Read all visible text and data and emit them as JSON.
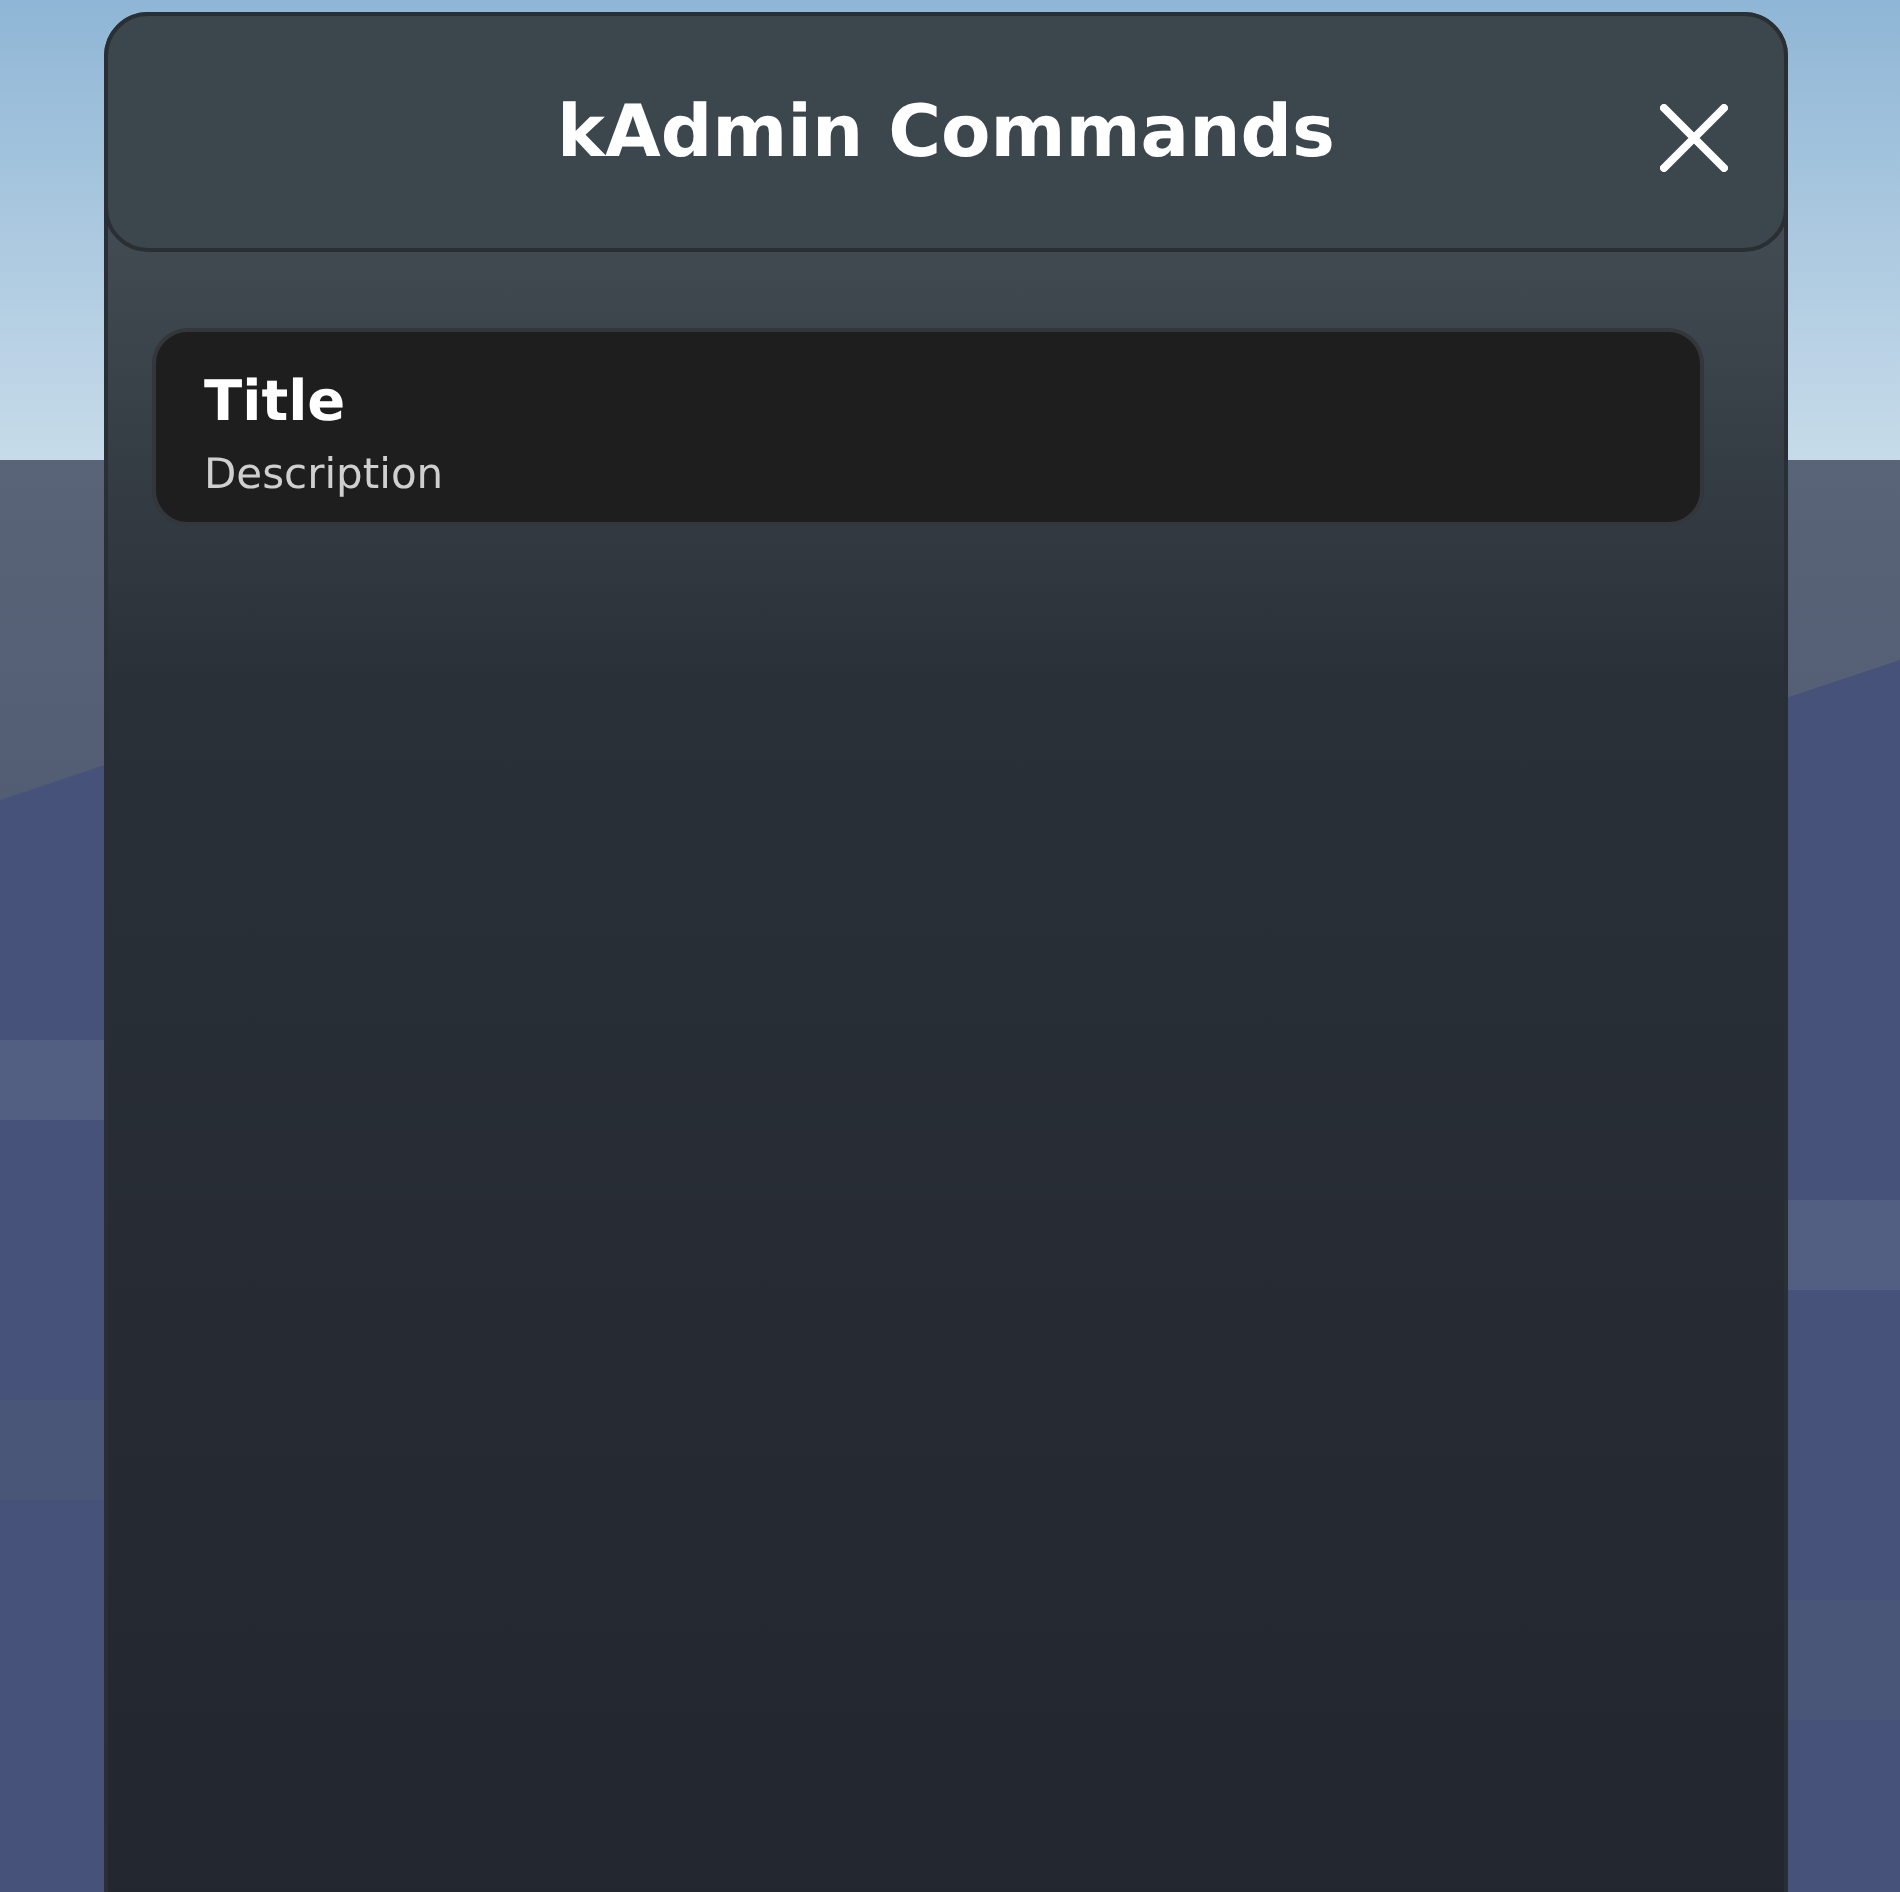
{
  "window": {
    "title": "kAdmin Commands"
  },
  "commands": [
    {
      "title": "Title",
      "description": "Description"
    }
  ]
}
